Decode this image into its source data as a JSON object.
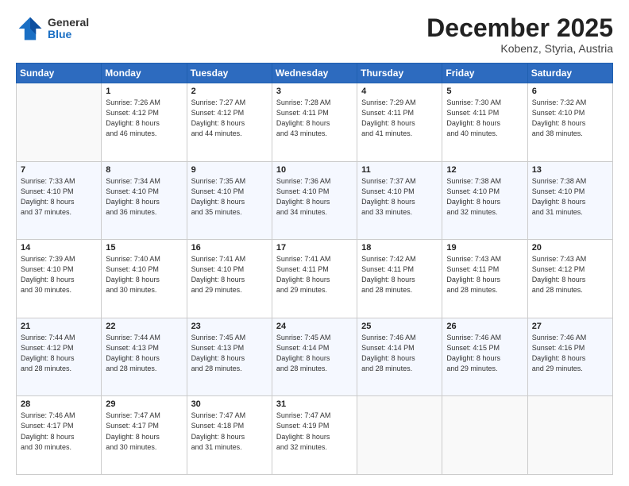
{
  "header": {
    "logo_general": "General",
    "logo_blue": "Blue",
    "month": "December 2025",
    "location": "Kobenz, Styria, Austria"
  },
  "days_of_week": [
    "Sunday",
    "Monday",
    "Tuesday",
    "Wednesday",
    "Thursday",
    "Friday",
    "Saturday"
  ],
  "weeks": [
    [
      {
        "num": "",
        "info": ""
      },
      {
        "num": "1",
        "info": "Sunrise: 7:26 AM\nSunset: 4:12 PM\nDaylight: 8 hours\nand 46 minutes."
      },
      {
        "num": "2",
        "info": "Sunrise: 7:27 AM\nSunset: 4:12 PM\nDaylight: 8 hours\nand 44 minutes."
      },
      {
        "num": "3",
        "info": "Sunrise: 7:28 AM\nSunset: 4:11 PM\nDaylight: 8 hours\nand 43 minutes."
      },
      {
        "num": "4",
        "info": "Sunrise: 7:29 AM\nSunset: 4:11 PM\nDaylight: 8 hours\nand 41 minutes."
      },
      {
        "num": "5",
        "info": "Sunrise: 7:30 AM\nSunset: 4:11 PM\nDaylight: 8 hours\nand 40 minutes."
      },
      {
        "num": "6",
        "info": "Sunrise: 7:32 AM\nSunset: 4:10 PM\nDaylight: 8 hours\nand 38 minutes."
      }
    ],
    [
      {
        "num": "7",
        "info": "Sunrise: 7:33 AM\nSunset: 4:10 PM\nDaylight: 8 hours\nand 37 minutes."
      },
      {
        "num": "8",
        "info": "Sunrise: 7:34 AM\nSunset: 4:10 PM\nDaylight: 8 hours\nand 36 minutes."
      },
      {
        "num": "9",
        "info": "Sunrise: 7:35 AM\nSunset: 4:10 PM\nDaylight: 8 hours\nand 35 minutes."
      },
      {
        "num": "10",
        "info": "Sunrise: 7:36 AM\nSunset: 4:10 PM\nDaylight: 8 hours\nand 34 minutes."
      },
      {
        "num": "11",
        "info": "Sunrise: 7:37 AM\nSunset: 4:10 PM\nDaylight: 8 hours\nand 33 minutes."
      },
      {
        "num": "12",
        "info": "Sunrise: 7:38 AM\nSunset: 4:10 PM\nDaylight: 8 hours\nand 32 minutes."
      },
      {
        "num": "13",
        "info": "Sunrise: 7:38 AM\nSunset: 4:10 PM\nDaylight: 8 hours\nand 31 minutes."
      }
    ],
    [
      {
        "num": "14",
        "info": "Sunrise: 7:39 AM\nSunset: 4:10 PM\nDaylight: 8 hours\nand 30 minutes."
      },
      {
        "num": "15",
        "info": "Sunrise: 7:40 AM\nSunset: 4:10 PM\nDaylight: 8 hours\nand 30 minutes."
      },
      {
        "num": "16",
        "info": "Sunrise: 7:41 AM\nSunset: 4:10 PM\nDaylight: 8 hours\nand 29 minutes."
      },
      {
        "num": "17",
        "info": "Sunrise: 7:41 AM\nSunset: 4:11 PM\nDaylight: 8 hours\nand 29 minutes."
      },
      {
        "num": "18",
        "info": "Sunrise: 7:42 AM\nSunset: 4:11 PM\nDaylight: 8 hours\nand 28 minutes."
      },
      {
        "num": "19",
        "info": "Sunrise: 7:43 AM\nSunset: 4:11 PM\nDaylight: 8 hours\nand 28 minutes."
      },
      {
        "num": "20",
        "info": "Sunrise: 7:43 AM\nSunset: 4:12 PM\nDaylight: 8 hours\nand 28 minutes."
      }
    ],
    [
      {
        "num": "21",
        "info": "Sunrise: 7:44 AM\nSunset: 4:12 PM\nDaylight: 8 hours\nand 28 minutes."
      },
      {
        "num": "22",
        "info": "Sunrise: 7:44 AM\nSunset: 4:13 PM\nDaylight: 8 hours\nand 28 minutes."
      },
      {
        "num": "23",
        "info": "Sunrise: 7:45 AM\nSunset: 4:13 PM\nDaylight: 8 hours\nand 28 minutes."
      },
      {
        "num": "24",
        "info": "Sunrise: 7:45 AM\nSunset: 4:14 PM\nDaylight: 8 hours\nand 28 minutes."
      },
      {
        "num": "25",
        "info": "Sunrise: 7:46 AM\nSunset: 4:14 PM\nDaylight: 8 hours\nand 28 minutes."
      },
      {
        "num": "26",
        "info": "Sunrise: 7:46 AM\nSunset: 4:15 PM\nDaylight: 8 hours\nand 29 minutes."
      },
      {
        "num": "27",
        "info": "Sunrise: 7:46 AM\nSunset: 4:16 PM\nDaylight: 8 hours\nand 29 minutes."
      }
    ],
    [
      {
        "num": "28",
        "info": "Sunrise: 7:46 AM\nSunset: 4:17 PM\nDaylight: 8 hours\nand 30 minutes."
      },
      {
        "num": "29",
        "info": "Sunrise: 7:47 AM\nSunset: 4:17 PM\nDaylight: 8 hours\nand 30 minutes."
      },
      {
        "num": "30",
        "info": "Sunrise: 7:47 AM\nSunset: 4:18 PM\nDaylight: 8 hours\nand 31 minutes."
      },
      {
        "num": "31",
        "info": "Sunrise: 7:47 AM\nSunset: 4:19 PM\nDaylight: 8 hours\nand 32 minutes."
      },
      {
        "num": "",
        "info": ""
      },
      {
        "num": "",
        "info": ""
      },
      {
        "num": "",
        "info": ""
      }
    ]
  ]
}
